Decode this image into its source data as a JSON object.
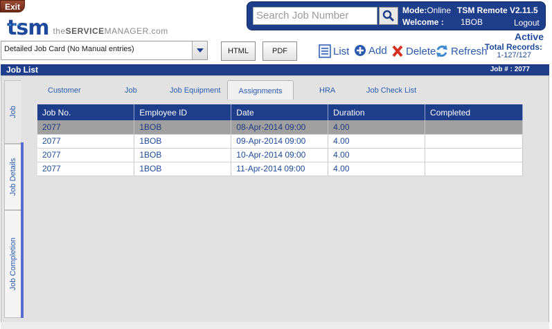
{
  "header": {
    "exit_label": "Exit",
    "logo_main": "tsm",
    "logo_sub_prefix": "the",
    "logo_sub_bold": "SERVICE",
    "logo_sub_suffix": "MANAGER.com",
    "search_placeholder": "Search Job Number",
    "mode_label": "Mode:",
    "mode_value": "Online",
    "app_name": "TSM Remote V2.11.5",
    "welcome_label": "Welcome :",
    "welcome_user": "1BOB",
    "logout_label": "Logout",
    "status": "Active",
    "records_label": "Total Records:",
    "records_value": "1-127/127"
  },
  "toolbar": {
    "report_selected": "Detailed Job Card (No Manual entries)",
    "html_label": "HTML",
    "pdf_label": "PDF",
    "list_label": "List",
    "add_label": "Add",
    "delete_label": "Delete",
    "refresh_label": "Refresh"
  },
  "joblist": {
    "title": "Job List",
    "job_number_label": "Job # :",
    "job_number": "2077"
  },
  "side_tabs": [
    "Job",
    "Job Details",
    "Job Completion"
  ],
  "tabs": [
    "Customer",
    "Job",
    "Job Equipment",
    "Assignments",
    "HRA",
    "Job Check List"
  ],
  "table": {
    "columns": [
      "Job No.",
      "Employee ID",
      "Date",
      "Duration",
      "Completed"
    ],
    "rows": [
      [
        "2077",
        "1BOB",
        "08-Apr-2014  09:00",
        "4.00",
        ""
      ],
      [
        "2077",
        "1BOB",
        "09-Apr-2014  09:00",
        "4.00",
        ""
      ],
      [
        "2077",
        "1BOB",
        "10-Apr-2014  09:00",
        "4.00",
        ""
      ],
      [
        "2077",
        "1BOB",
        "11-Apr-2014  09:00",
        "4.00",
        ""
      ]
    ]
  },
  "colors": {
    "brand_blue": "#1e3e8c",
    "link_blue": "#2a5ab0",
    "selected_row": "#a0a0a0"
  }
}
